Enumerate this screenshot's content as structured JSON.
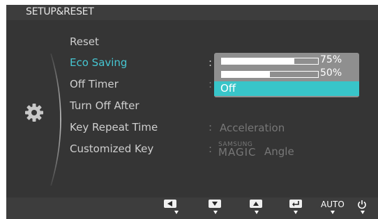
{
  "header": {
    "title": "SETUP&RESET"
  },
  "menu": {
    "items": [
      {
        "label": "Reset"
      },
      {
        "label": "Eco Saving"
      },
      {
        "label": "Off Timer"
      },
      {
        "label": "Turn Off After"
      },
      {
        "label": "Key Repeat Time"
      },
      {
        "label": "Customized Key"
      }
    ],
    "active_item": "Eco Saving"
  },
  "values": {
    "separator": ":",
    "key_repeat_time": "Acceleration",
    "customized_key_brand_top": "SAMSUNG",
    "customized_key_brand_bottom": "MAGIC",
    "customized_key_suffix": "Angle"
  },
  "eco_dropdown": {
    "options": [
      {
        "label": "75%",
        "level": 0.75
      },
      {
        "label": "50%",
        "level": 0.5
      },
      {
        "label": "Off",
        "selected": true
      }
    ]
  },
  "bottom_bar": {
    "buttons": [
      "left-arrow",
      "down-arrow",
      "up-arrow",
      "enter",
      "AUTO",
      "power"
    ],
    "auto_label": "AUTO"
  },
  "colors": {
    "accent": "#46c6d2",
    "selected_bg": "#38c5c9",
    "panel_bg": "#353535",
    "bar_bg": "#3d3d3d"
  }
}
